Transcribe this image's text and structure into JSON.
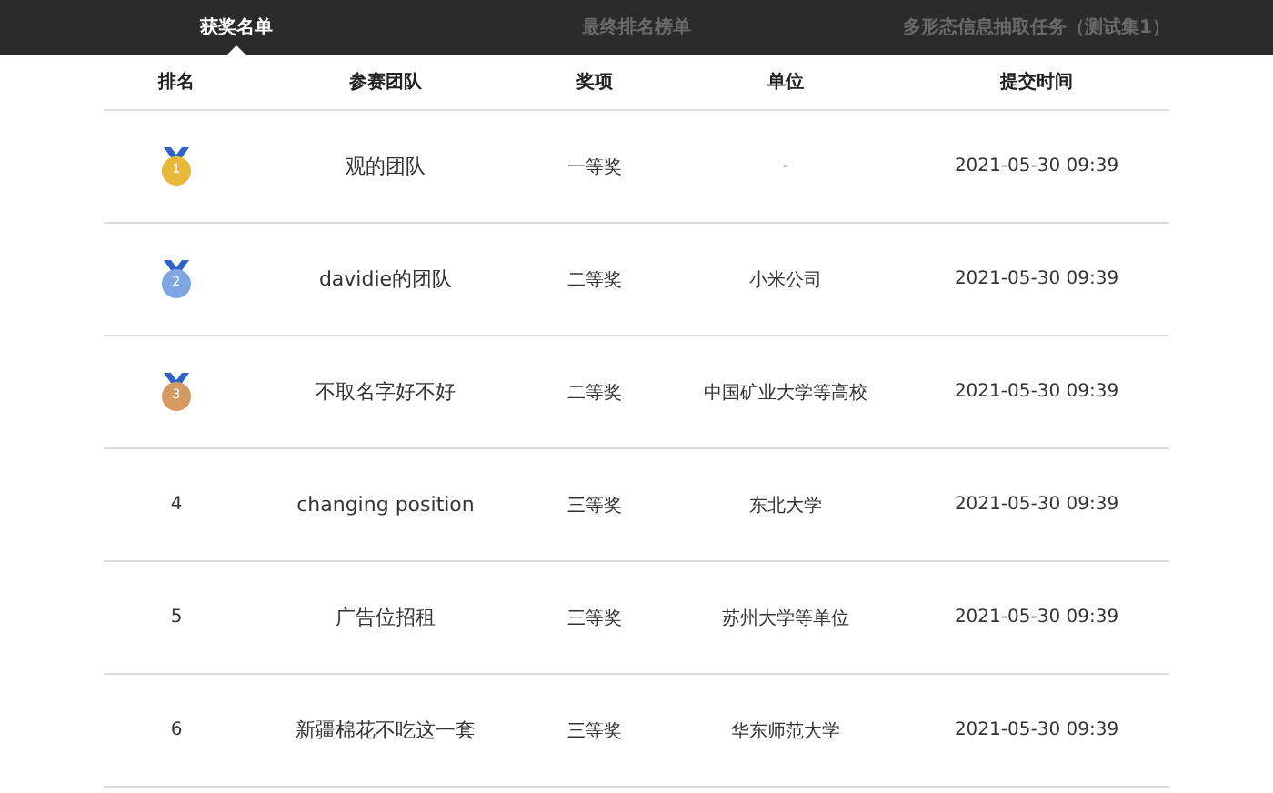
{
  "tabs": [
    {
      "label": "获奖名单",
      "selected": true
    },
    {
      "label": "最终排名榜单",
      "selected": false
    },
    {
      "label": "多形态信息抽取任务（测试集1）",
      "selected": false
    }
  ],
  "table": {
    "columns": [
      "排名",
      "参赛团队",
      "奖项",
      "单位",
      "提交时间"
    ],
    "rows": [
      {
        "rank": {
          "kind": "medal",
          "text": "1",
          "color": "#e8b83a"
        },
        "team": "观的团队",
        "award": "一等奖",
        "org": "-",
        "time": "2021-05-30 09:39"
      },
      {
        "rank": {
          "kind": "medal",
          "text": "2",
          "color": "#7fa6e0"
        },
        "team": "davidie的团队",
        "award": "二等奖",
        "org": "小米公司",
        "time": "2021-05-30 09:39"
      },
      {
        "rank": {
          "kind": "medal",
          "text": "3",
          "color": "#d59a63"
        },
        "team": "不取名字好不好",
        "award": "二等奖",
        "org": "中国矿业大学等高校",
        "time": "2021-05-30 09:39"
      },
      {
        "rank": {
          "kind": "number",
          "text": "4"
        },
        "team": "changing position",
        "award": "三等奖",
        "org": "东北大学",
        "time": "2021-05-30 09:39"
      },
      {
        "rank": {
          "kind": "number",
          "text": "5"
        },
        "team": "广告位招租",
        "award": "三等奖",
        "org": "苏州大学等单位",
        "time": "2021-05-30 09:39"
      },
      {
        "rank": {
          "kind": "number",
          "text": "6"
        },
        "team": "新疆棉花不吃这一套",
        "award": "三等奖",
        "org": "华东师范大学",
        "time": "2021-05-30 09:39"
      }
    ]
  }
}
